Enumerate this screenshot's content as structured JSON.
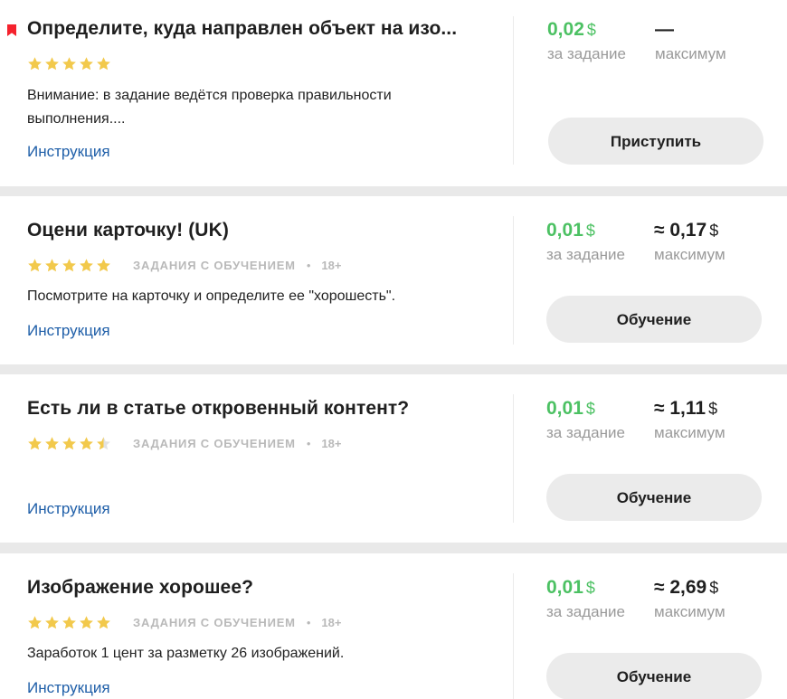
{
  "tasks": [
    {
      "title": "Определите, куда направлен объект на изо...",
      "rating": 5,
      "tag": "",
      "age": "",
      "description": "Внимание: в задание ведётся проверка правильности выполнения....",
      "instruction_link": "Инструкция",
      "price": "0,02",
      "price_currency": "$",
      "price_label": "за задание",
      "max": "—",
      "max_currency": "",
      "max_label": "максимум",
      "button_label": "Приступить",
      "bookmarked": true
    },
    {
      "title": "Оцени карточку! (UK)",
      "rating": 5,
      "tag": "ЗАДАНИЯ С ОБУЧЕНИЕМ",
      "dot": "•",
      "age": "18+",
      "description": "Посмотрите на карточку и определите ее \"хорошесть\".",
      "instruction_link": "Инструкция",
      "price": "0,01",
      "price_currency": "$",
      "price_label": "за задание",
      "max": "≈ 0,17",
      "max_currency": "$",
      "max_label": "максимум",
      "button_label": "Обучение",
      "bookmarked": false
    },
    {
      "title": "Есть ли в статье откровенный контент?",
      "rating": 4.5,
      "tag": "ЗАДАНИЯ С ОБУЧЕНИЕМ",
      "dot": "•",
      "age": "18+",
      "description": "",
      "instruction_link": "Инструкция",
      "price": "0,01",
      "price_currency": "$",
      "price_label": "за задание",
      "max": "≈ 1,11",
      "max_currency": "$",
      "max_label": "максимум",
      "button_label": "Обучение",
      "bookmarked": false
    },
    {
      "title": "Изображение хорошее?",
      "rating": 5,
      "tag": "ЗАДАНИЯ С ОБУЧЕНИЕМ",
      "dot": "•",
      "age": "18+",
      "description": "Заработок 1 цент за разметку 26 изображений.",
      "instruction_link": "Инструкция",
      "price": "0,01",
      "price_currency": "$",
      "price_label": "за задание",
      "max": "≈ 2,69",
      "max_currency": "$",
      "max_label": "максимум",
      "button_label": "Обучение",
      "bookmarked": false
    }
  ],
  "colors": {
    "star": "#f2c94c",
    "star_empty": "#e2e2e2",
    "price_green": "#4cc163",
    "link_blue": "#1e5ea8",
    "bookmark_red": "#f5222d"
  },
  "icons": {
    "bookmark": "bookmark-icon",
    "star": "star-icon"
  }
}
